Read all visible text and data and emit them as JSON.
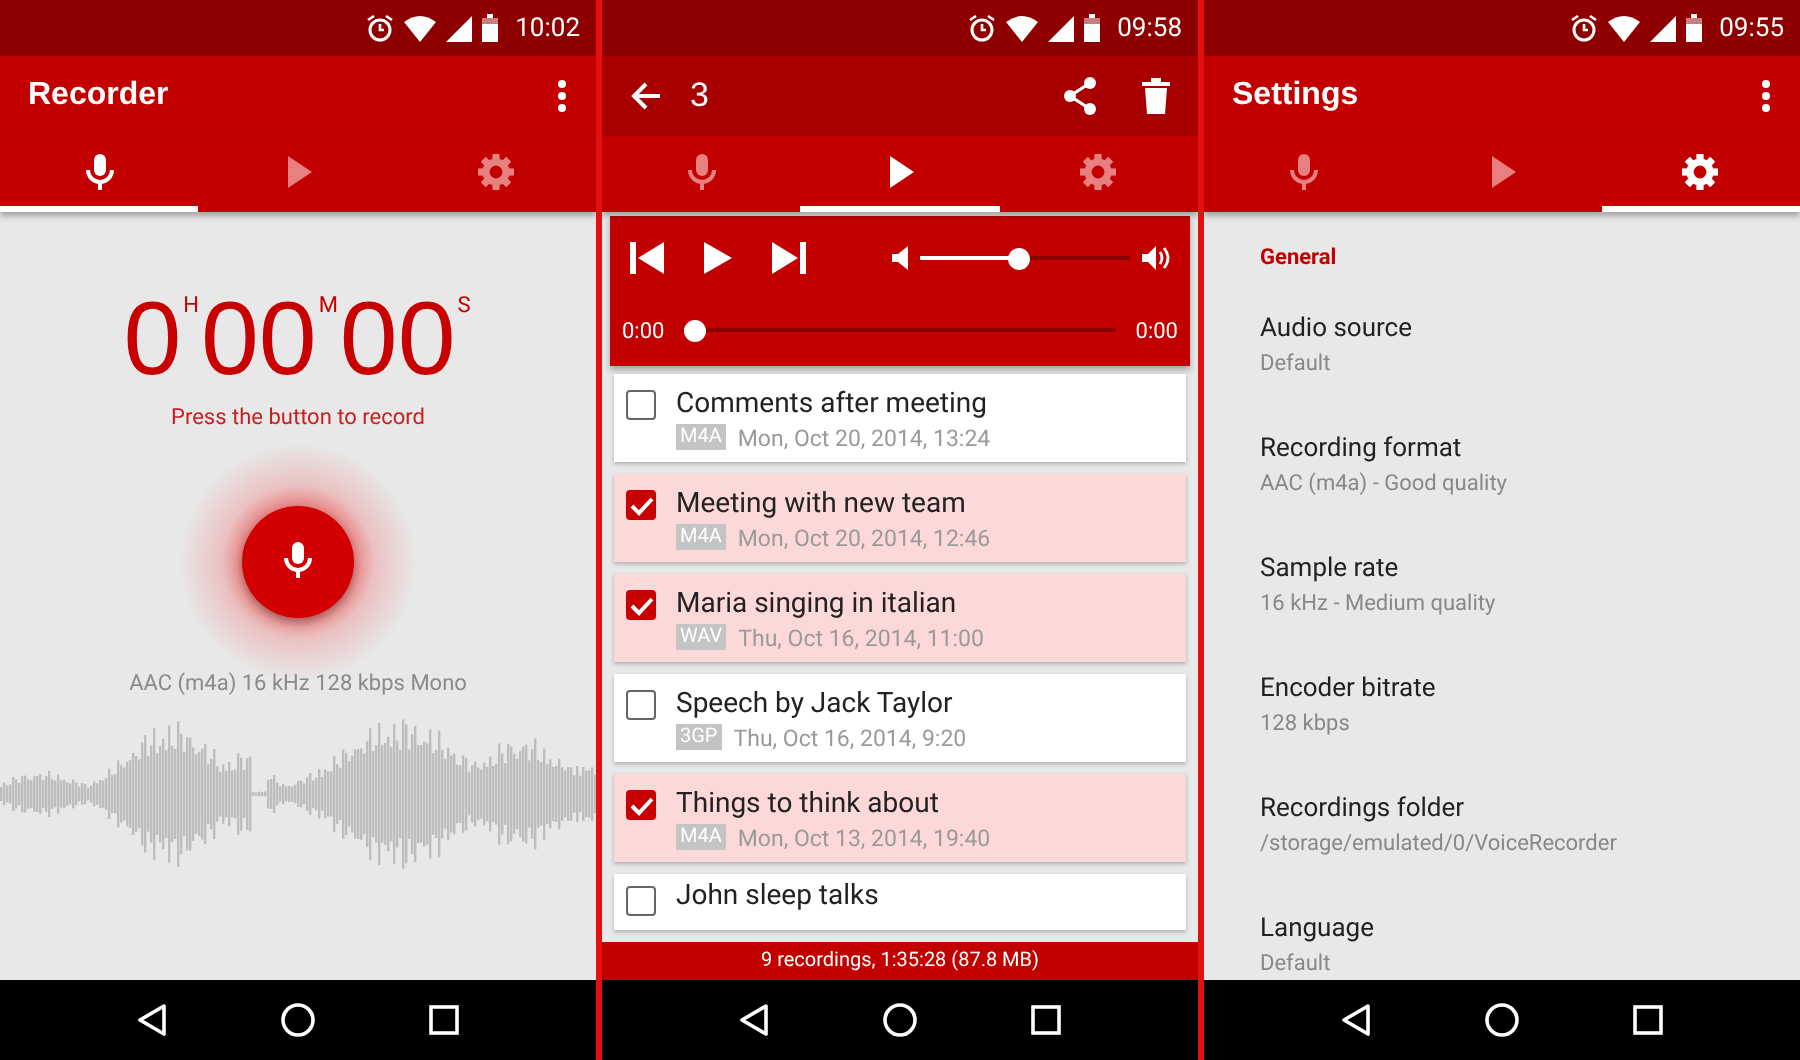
{
  "screens": [
    {
      "kind": "recorder",
      "status_time": "10:02",
      "title": "Recorder",
      "tabs": [
        {
          "kind": "record",
          "selected": true
        },
        {
          "kind": "play",
          "selected": false
        },
        {
          "kind": "settings",
          "selected": false
        }
      ],
      "timer": {
        "hours": "0",
        "hours_unit": "H",
        "minutes": "00",
        "minutes_unit": "M",
        "seconds": "00",
        "seconds_unit": "S"
      },
      "hint": "Press the button to record",
      "format": "AAC (m4a) 16 kHz 128 kbps Mono"
    },
    {
      "kind": "player",
      "status_time": "09:58",
      "selection_count": "3",
      "tabs": [
        {
          "kind": "record",
          "selected": false
        },
        {
          "kind": "play",
          "selected": true
        },
        {
          "kind": "settings",
          "selected": false
        }
      ],
      "player": {
        "volume": {
          "level": 0.47
        },
        "seek": {
          "level": 0
        },
        "elapsed": "0:00",
        "total": "0:00"
      },
      "recordings": [
        {
          "title": "Comments after meeting",
          "format": "M4A",
          "date": "Mon, Oct 20, 2014, 13:24",
          "checked": false
        },
        {
          "title": "Meeting with new team",
          "format": "M4A",
          "date": "Mon, Oct 20, 2014, 12:46",
          "checked": true
        },
        {
          "title": "Maria singing in italian",
          "format": "WAV",
          "date": "Thu, Oct 16, 2014, 11:00",
          "checked": true
        },
        {
          "title": "Speech by Jack Taylor",
          "format": "3GP",
          "date": "Thu, Oct 16, 2014, 9:20",
          "checked": false
        },
        {
          "title": "Things to think about",
          "format": "M4A",
          "date": "Mon, Oct 13, 2014, 19:40",
          "checked": true
        },
        {
          "title": "John sleep talks",
          "checked": false
        }
      ],
      "footer": "9 recordings, 1:35:28 (87.8 MB)"
    },
    {
      "kind": "settings",
      "status_time": "09:55",
      "title": "Settings",
      "tabs": [
        {
          "kind": "record",
          "selected": false
        },
        {
          "kind": "play",
          "selected": false
        },
        {
          "kind": "settings",
          "selected": true
        }
      ],
      "section": "General",
      "settings": [
        {
          "title": "Audio source",
          "value": "Default"
        },
        {
          "title": "Recording format",
          "value": "AAC (m4a) - Good quality"
        },
        {
          "title": "Sample rate",
          "value": "16 kHz - Medium quality"
        },
        {
          "title": "Encoder bitrate",
          "value": "128 kbps"
        },
        {
          "title": "Recordings folder",
          "value": "/storage/emulated/0/VoiceRecorder"
        },
        {
          "title": "Language",
          "value": "Default"
        }
      ]
    }
  ]
}
